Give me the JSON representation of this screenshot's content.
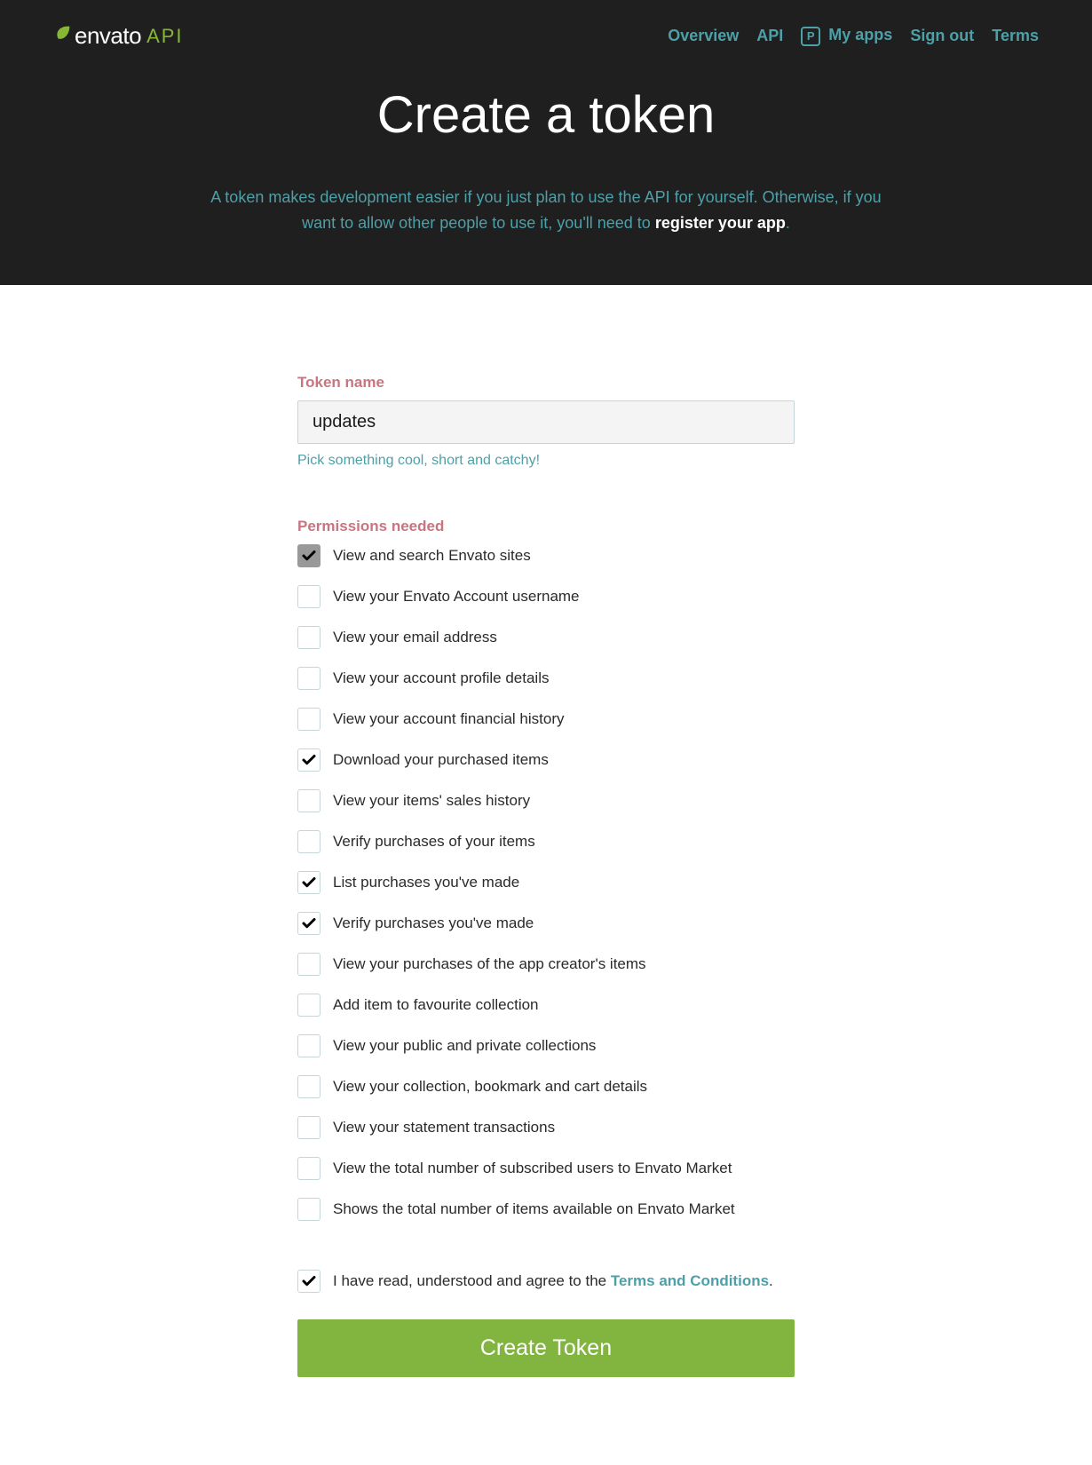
{
  "header": {
    "logo_text": "envato",
    "logo_api": "API",
    "nav": {
      "overview": "Overview",
      "api": "API",
      "badge": "P",
      "my_apps": "My apps",
      "sign_out": "Sign out",
      "terms": "Terms"
    },
    "title": "Create a token",
    "subtitle_pre": "A token makes development easier if you just plan to use the API for yourself. Otherwise, if you want to allow other people to use it, you'll need to ",
    "subtitle_link": "register your app",
    "subtitle_post": "."
  },
  "form": {
    "token_name_label": "Token name",
    "token_name_value": "updates",
    "token_name_hint": "Pick something cool, short and catchy!",
    "permissions_label": "Permissions needed",
    "permissions": [
      {
        "label": "View and search Envato sites",
        "checked": true,
        "disabled": true
      },
      {
        "label": "View your Envato Account username",
        "checked": false,
        "disabled": false
      },
      {
        "label": "View your email address",
        "checked": false,
        "disabled": false
      },
      {
        "label": "View your account profile details",
        "checked": false,
        "disabled": false
      },
      {
        "label": "View your account financial history",
        "checked": false,
        "disabled": false
      },
      {
        "label": "Download your purchased items",
        "checked": true,
        "disabled": false
      },
      {
        "label": "View your items' sales history",
        "checked": false,
        "disabled": false
      },
      {
        "label": "Verify purchases of your items",
        "checked": false,
        "disabled": false
      },
      {
        "label": "List purchases you've made",
        "checked": true,
        "disabled": false
      },
      {
        "label": "Verify purchases you've made",
        "checked": true,
        "disabled": false
      },
      {
        "label": "View your purchases of the app creator's items",
        "checked": false,
        "disabled": false
      },
      {
        "label": "Add item to favourite collection",
        "checked": false,
        "disabled": false
      },
      {
        "label": "View your public and private collections",
        "checked": false,
        "disabled": false
      },
      {
        "label": "View your collection, bookmark and cart details",
        "checked": false,
        "disabled": false
      },
      {
        "label": "View your statement transactions",
        "checked": false,
        "disabled": false
      },
      {
        "label": "View the total number of subscribed users to Envato Market",
        "checked": false,
        "disabled": false
      },
      {
        "label": "Shows the total number of items available on Envato Market",
        "checked": false,
        "disabled": false
      }
    ],
    "terms": {
      "checked": true,
      "pre": "I have read, understood and agree to the ",
      "link": "Terms and Conditions",
      "post": "."
    },
    "submit_label": "Create Token"
  }
}
